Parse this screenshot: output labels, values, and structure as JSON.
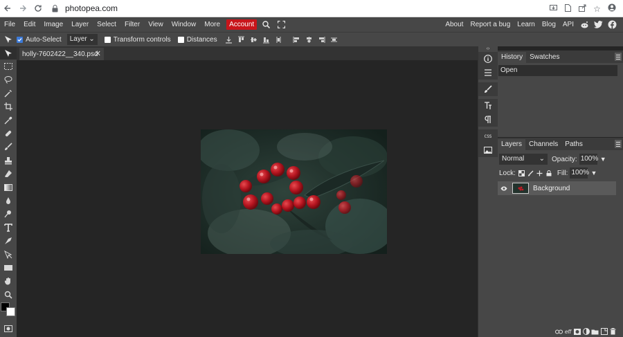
{
  "browser": {
    "url": "photopea.com",
    "icons": [
      "back-icon",
      "forward-icon",
      "reload-icon",
      "lock-icon",
      "install-icon",
      "page-icon",
      "share-icon",
      "star-icon",
      "profile-icon"
    ]
  },
  "menu": {
    "items": [
      "File",
      "Edit",
      "Image",
      "Layer",
      "Select",
      "Filter",
      "View",
      "Window",
      "More"
    ],
    "account": "Account",
    "account_color": "#c8151b",
    "right_items": [
      "About",
      "Report a bug",
      "Learn",
      "Blog",
      "API"
    ]
  },
  "options": {
    "auto_select": "Auto-Select",
    "auto_select_checked": true,
    "target": "Layer",
    "transform_controls": "Transform controls",
    "distances": "Distances"
  },
  "document": {
    "tab_title": "holly-7602422__340.psd",
    "close_glyph": "✕"
  },
  "history": {
    "tabs": [
      "History",
      "Swatches"
    ],
    "entries": [
      "Open"
    ]
  },
  "layers": {
    "tabs": [
      "Layers",
      "Channels",
      "Paths"
    ],
    "blend_mode": "Normal",
    "opacity_label": "Opacity:",
    "opacity": "100%",
    "lock_label": "Lock:",
    "fill_label": "Fill:",
    "fill": "100%",
    "items": [
      {
        "name": "Background",
        "visible": true
      }
    ]
  },
  "colors": {
    "accent": "#3d7bd9",
    "panel": "#474747",
    "canvas_bg": "#252525"
  }
}
